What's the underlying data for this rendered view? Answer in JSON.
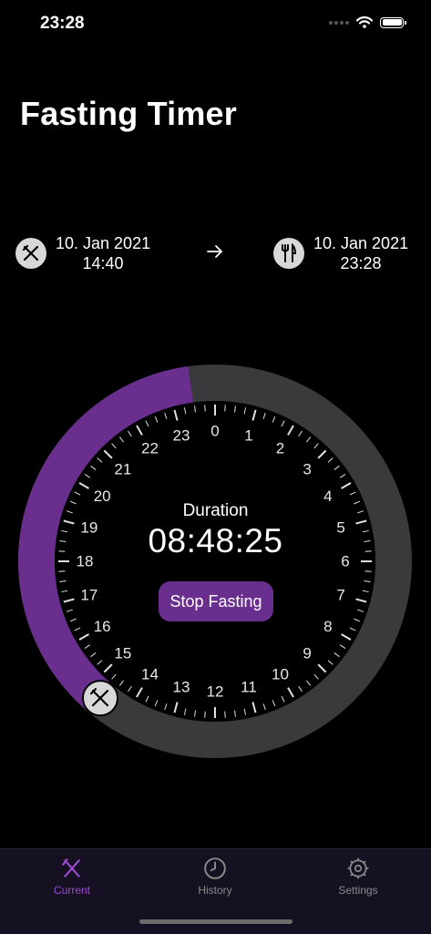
{
  "status_bar": {
    "time": "23:28"
  },
  "title": "Fasting Timer",
  "start": {
    "date": "10. Jan 2021",
    "time": "14:40"
  },
  "end": {
    "date": "10. Jan 2021",
    "time": "23:28"
  },
  "timer": {
    "duration_label": "Duration",
    "duration_value": "08:48:25",
    "stop_label": "Stop Fasting",
    "progress_fraction": 0.367,
    "start_hour_marker": 14.667,
    "hour_labels": [
      "0",
      "1",
      "2",
      "3",
      "4",
      "5",
      "6",
      "7",
      "8",
      "9",
      "10",
      "11",
      "12",
      "13",
      "14",
      "15",
      "16",
      "17",
      "18",
      "19",
      "20",
      "21",
      "22",
      "23"
    ]
  },
  "tabs": [
    {
      "label": "Current",
      "active": true
    },
    {
      "label": "History",
      "active": false
    },
    {
      "label": "Settings",
      "active": false
    }
  ],
  "colors": {
    "accent": "#6a2e8e",
    "track": "#3a3a3c",
    "active_tab": "#9a4bd0"
  }
}
